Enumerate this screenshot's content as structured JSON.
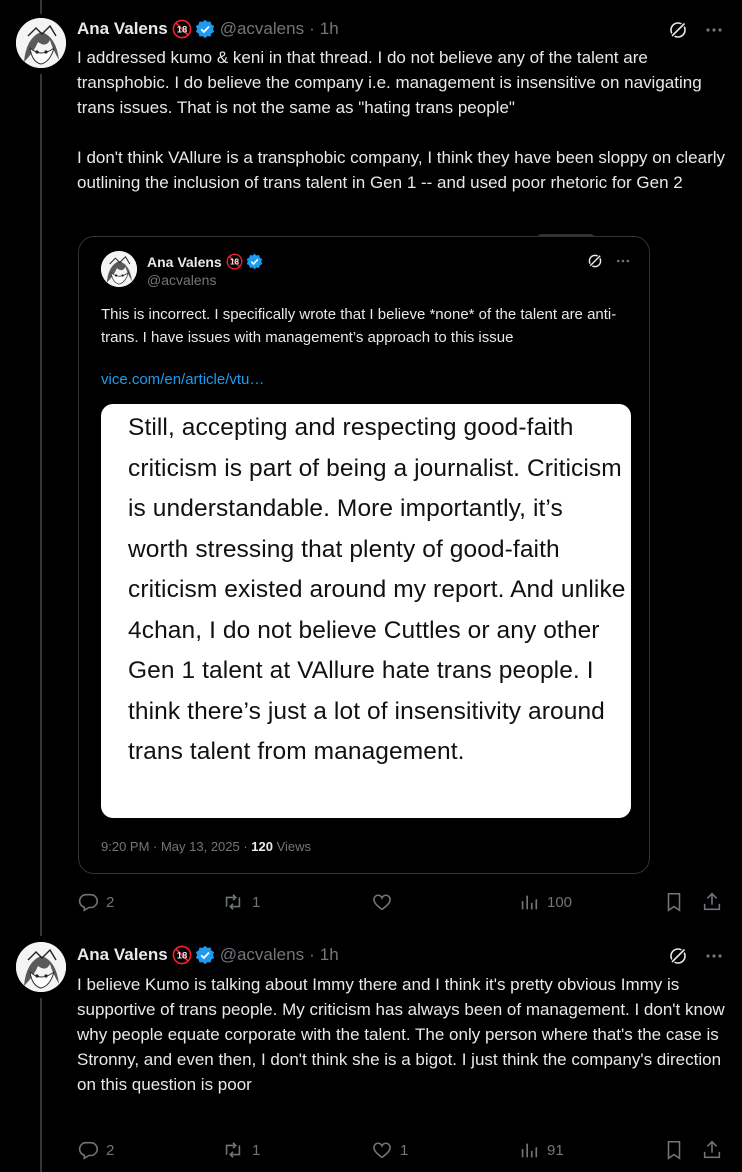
{
  "tweets": [
    {
      "author": {
        "name": "Ana Valens",
        "age_badge": "18",
        "handle": "@acvalens",
        "time": "1h"
      },
      "paragraphs": [
        "I addressed kumo & keni in that thread. I do not believe any of the talent are transphobic. I do believe the company i.e. management is insensitive on navigating trans issues. That is not the same as \"hating trans people\"",
        "I don't think VAllure is a transphobic company, I think they have been sloppy on clearly outlining the inclusion of trans talent in Gen 1 -- and used poor rhetoric for Gen 2"
      ],
      "quote": {
        "author": {
          "name": "Ana Valens",
          "age_badge": "18",
          "handle": "@acvalens"
        },
        "text": "This is incorrect. I specifically wrote that I believe *none* of the talent are anti-trans. I have issues with management’s approach to this issue",
        "link": "vice.com/en/article/vtu…",
        "card_text": "Still, accepting and respecting good-faith criticism is part of being a journalist. Criticism is understandable. More importantly, it’s worth stressing that plenty of good-faith criticism existed around my report. And unlike 4chan, I do not believe Cuttles or any other Gen 1 talent at VAllure hate trans people. I think there’s just a lot of insensitivity around trans talent from management.",
        "timestamp": "9:20 PM · May 13, 2025 · ",
        "views_count": "120",
        "views_label": " Views"
      },
      "stats": {
        "replies": "2",
        "reposts": "1",
        "likes": "",
        "views": "100"
      }
    },
    {
      "author": {
        "name": "Ana Valens",
        "age_badge": "18",
        "handle": "@acvalens",
        "time": "1h"
      },
      "paragraphs": [
        "I believe Kumo is talking about Immy there and I think it's pretty obvious Immy is supportive of trans people. My criticism has always been of management. I don't know why people equate corporate with the talent. The only person where that's the case is Stronny, and even then, I don't think she is a bigot. I just think the company's direction on this question is poor"
      ],
      "stats": {
        "replies": "2",
        "reposts": "1",
        "likes": "1",
        "views": "91"
      }
    }
  ],
  "colors": {
    "background": "#000000",
    "text": "#e7e9ea",
    "muted": "#71767b",
    "link": "#1d9bf0",
    "verified": "#1d9bf0",
    "border": "#2f3336"
  }
}
